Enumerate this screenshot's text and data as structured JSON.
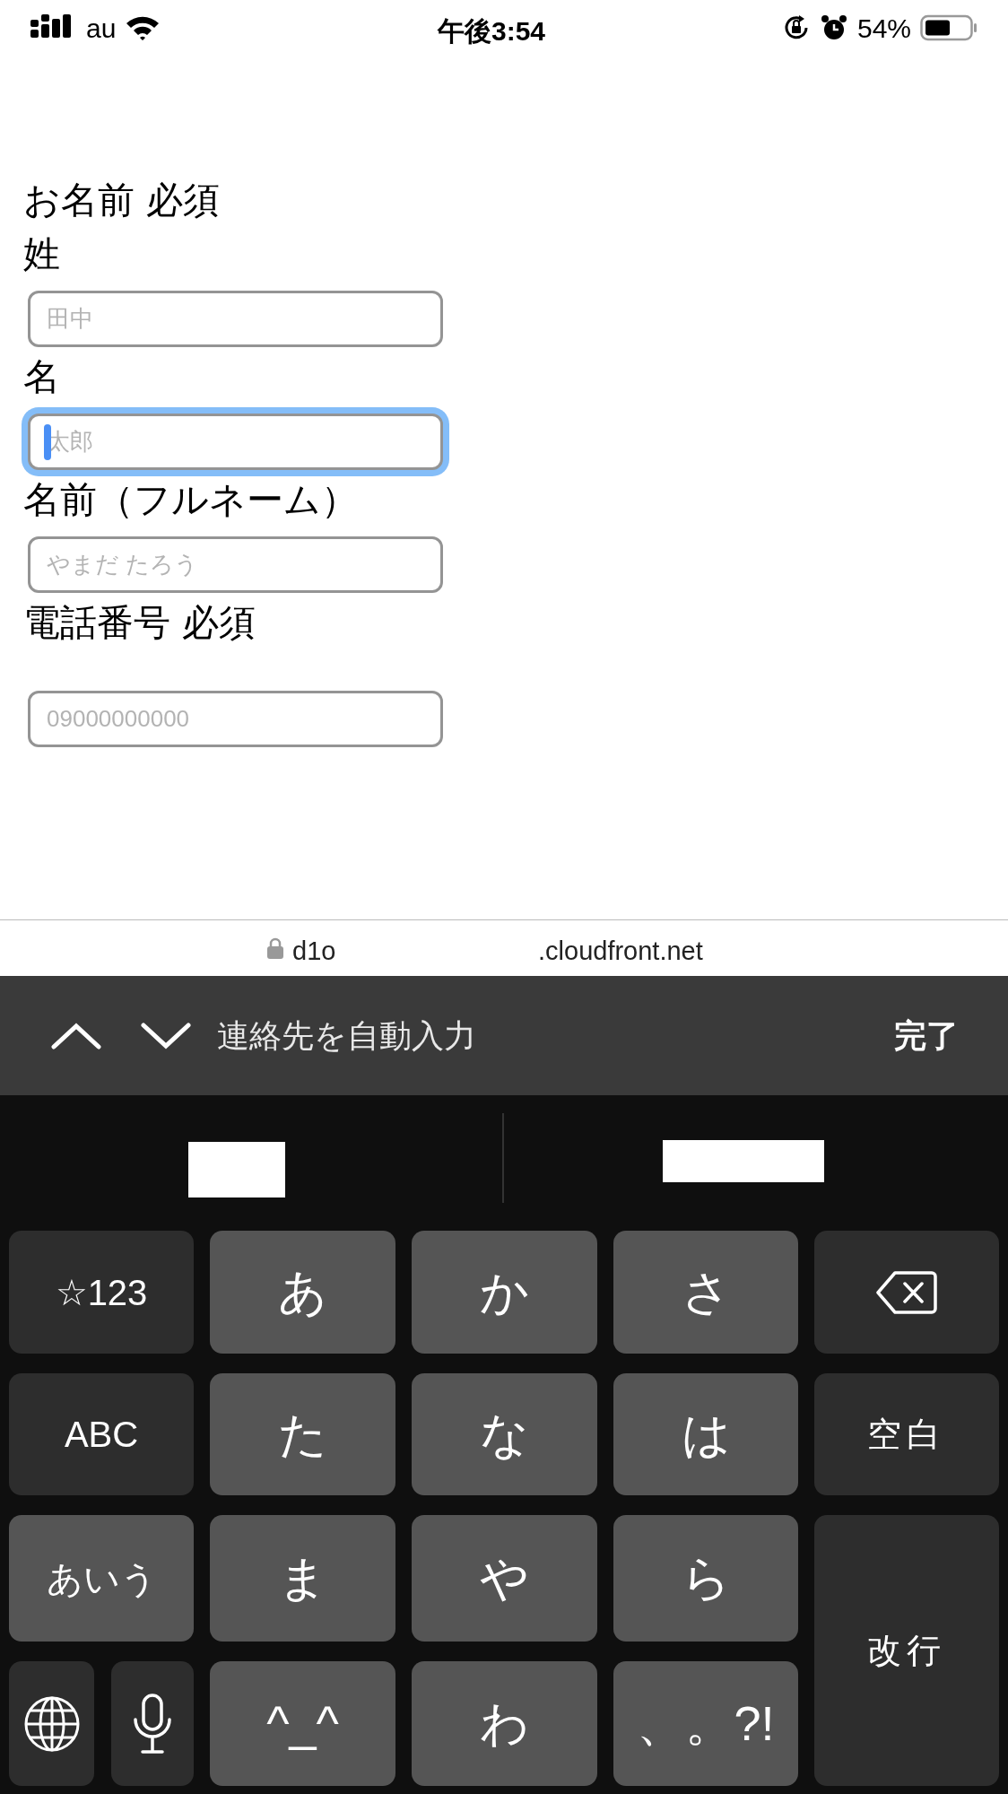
{
  "status_bar": {
    "carrier": "au",
    "time": "午後3:54",
    "battery": "54%"
  },
  "form_items": [
    {
      "kind": "label",
      "text": "お名前 必須"
    },
    {
      "kind": "label",
      "text": "姓"
    },
    {
      "kind": "field",
      "placeholder": "田中",
      "focused": false
    },
    {
      "kind": "label",
      "text": "名"
    },
    {
      "kind": "field",
      "placeholder": "太郎",
      "focused": true
    },
    {
      "kind": "label",
      "text": "名前（フルネーム）"
    },
    {
      "kind": "field",
      "placeholder": "やまだ たろう",
      "focused": false
    },
    {
      "kind": "label",
      "text": "電話番号 必須"
    },
    {
      "kind": "field",
      "placeholder": "09000000000",
      "focused": false,
      "gap": true
    }
  ],
  "url_bar": {
    "domain_start": "d1o",
    "domain_end": ".cloudfront.net"
  },
  "autofill_bar": {
    "label": "連絡先を自動入力",
    "done": "完了"
  },
  "keyboard": {
    "keys": [
      {
        "kind": "mode",
        "label": "☆123",
        "selected": false
      },
      {
        "kind": "char",
        "label": "あ"
      },
      {
        "kind": "char",
        "label": "か"
      },
      {
        "kind": "char",
        "label": "さ"
      },
      {
        "kind": "delete"
      },
      {
        "kind": "mode",
        "label": "ABC",
        "selected": false
      },
      {
        "kind": "char",
        "label": "た"
      },
      {
        "kind": "char",
        "label": "な"
      },
      {
        "kind": "char",
        "label": "は"
      },
      {
        "kind": "space",
        "label": "空白"
      },
      {
        "kind": "mode",
        "label": "あいう",
        "selected": true
      },
      {
        "kind": "char",
        "label": "ま"
      },
      {
        "kind": "char",
        "label": "や"
      },
      {
        "kind": "char",
        "label": "ら"
      },
      {
        "kind": "return",
        "label": "改行"
      },
      {
        "kind": "globe"
      },
      {
        "kind": "mic"
      },
      {
        "kind": "char",
        "label": "^_^"
      },
      {
        "kind": "char",
        "label": "わ"
      },
      {
        "kind": "char",
        "label": "、。?!"
      }
    ]
  }
}
